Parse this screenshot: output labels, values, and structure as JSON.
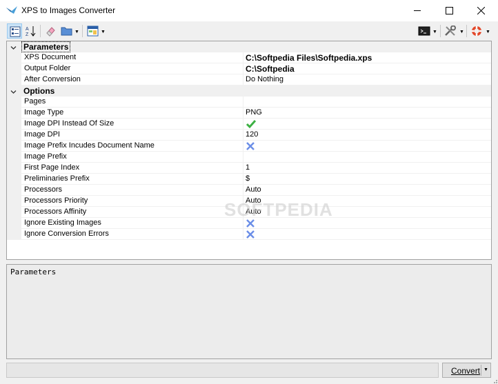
{
  "window": {
    "title": "XPS to Images Converter"
  },
  "titlebar_buttons": {
    "minimize_icon": "minimize-icon",
    "maximize_icon": "maximize-icon",
    "close_icon": "close-icon"
  },
  "toolbar": {
    "items": [
      "categorized-icon",
      "alphabetical-icon",
      "eraser-icon",
      "folder-icon",
      "layout-icon",
      "console-icon",
      "tools-icon",
      "help-icon"
    ]
  },
  "grid": {
    "categories": [
      {
        "label": "Parameters",
        "rows": [
          {
            "name": "XPS Document",
            "value": "C:\\Softpedia Files\\Softpedia.xps",
            "style": "bold"
          },
          {
            "name": "Output Folder",
            "value": "C:\\Softpedia",
            "style": "bold"
          },
          {
            "name": "After Conversion",
            "value": "Do Nothing",
            "style": "normal"
          }
        ]
      },
      {
        "label": "Options",
        "rows": [
          {
            "name": "Pages",
            "value": "",
            "style": "normal"
          },
          {
            "name": "Image Type",
            "value": "PNG",
            "style": "normal"
          },
          {
            "name": "Image DPI Instead Of Size",
            "value": "check-icon",
            "style": "icon"
          },
          {
            "name": "Image DPI",
            "value": "120",
            "style": "normal"
          },
          {
            "name": "Image Prefix Incudes Document Name",
            "value": "cross-icon",
            "style": "icon"
          },
          {
            "name": "Image Prefix",
            "value": "",
            "style": "normal"
          },
          {
            "name": "First Page Index",
            "value": "1",
            "style": "normal"
          },
          {
            "name": "Preliminaries Prefix",
            "value": "$",
            "style": "normal"
          },
          {
            "name": "Processors",
            "value": "Auto",
            "style": "normal"
          },
          {
            "name": "Processors Priority",
            "value": "Auto",
            "style": "normal"
          },
          {
            "name": "Processors Affinity",
            "value": "Auto",
            "style": "normal"
          },
          {
            "name": "Ignore Existing Images",
            "value": "cross-icon",
            "style": "icon"
          },
          {
            "name": "Ignore Conversion Errors",
            "value": "cross-icon",
            "style": "icon"
          }
        ]
      }
    ]
  },
  "description": {
    "text": "Parameters"
  },
  "footer": {
    "convert_label": "Convert"
  },
  "watermark": "SOFTPEDIA",
  "colors": {
    "check": "#3cb043",
    "cross": "#6b8ee8",
    "selection": "#cce4f7"
  }
}
